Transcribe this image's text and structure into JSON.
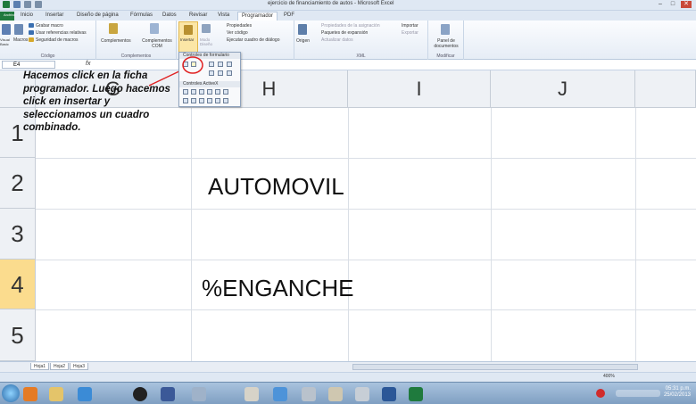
{
  "window": {
    "title": "ejercicio de financiamiento de autos - Microsoft Excel"
  },
  "ribbon_tabs": [
    "Archivo",
    "Inicio",
    "Insertar",
    "Diseño de página",
    "Fórmulas",
    "Datos",
    "Revisar",
    "Vista",
    "Programador",
    "PDF"
  ],
  "active_tab": "Programador",
  "ribbon": {
    "codigo": {
      "label": "Código",
      "items": [
        "Grabar macro",
        "Usar referencias relativas",
        "Seguridad de macros"
      ],
      "basic": "Visual Basic",
      "macros": "Macros"
    },
    "complementos": {
      "label": "Complementos",
      "items": [
        "Complementos",
        "Complementos COM"
      ]
    },
    "controles": {
      "insertar": "Insertar",
      "modo_diseno": "Modo Diseño",
      "items": [
        "Propiedades",
        "Ver código",
        "Ejecutar cuadro de diálogo"
      ]
    },
    "xml": {
      "label": "XML",
      "origen": "Origen",
      "items": [
        "Propiedades de la asignación",
        "Paquetes de expansión",
        "Actualizar datos"
      ],
      "items2": [
        "Importar",
        "Exportar"
      ]
    },
    "modificar": {
      "label": "Modificar",
      "panel": "Panel de documentos"
    }
  },
  "dropdown": {
    "form_controls": "Controles de formulario",
    "activex": "Controles ActiveX"
  },
  "formula_bar": {
    "name_box": "E4",
    "fx": "fx"
  },
  "columns": [
    "G",
    "H",
    "I",
    "J"
  ],
  "rows": [
    "1",
    "2",
    "3",
    "4",
    "5"
  ],
  "cells": {
    "h2": "AUTOMOVIL",
    "h4": "%ENGANCHE"
  },
  "annotation": "Hacemos click en la ficha programador. Luego hacemos click en insertar y seleccionamos un cuadro combinado.",
  "sheet_tabs": [
    "Hoja1",
    "Hoja2",
    "Hoja3"
  ],
  "status": {
    "zoom": "400%"
  },
  "clock": {
    "time": "05:31 p.m.",
    "date": "25/02/2013"
  },
  "colors": {
    "file_tab": "#1f7a3d",
    "selected_row": "#fbdc8e",
    "annotation_arrow": "#e02020"
  }
}
